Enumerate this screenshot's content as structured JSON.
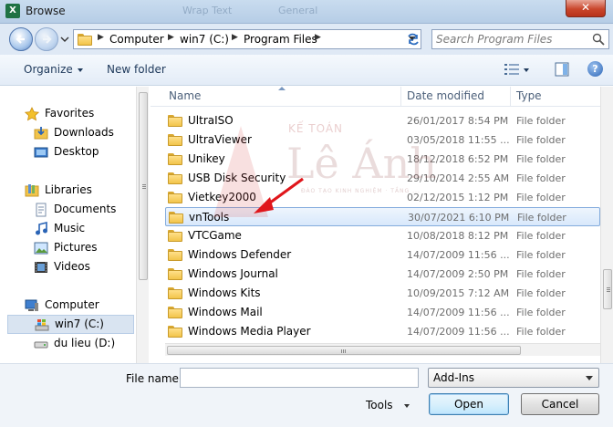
{
  "window": {
    "title": "Browse",
    "app_icon_letter": "X",
    "close_glyph": "✕"
  },
  "background_ghost": [
    "Wrap Text",
    "General"
  ],
  "address": {
    "crumbs": [
      "Computer",
      "win7 (C:)",
      "Program Files"
    ],
    "search_placeholder": "Search Program Files"
  },
  "toolbar": {
    "organize": "Organize",
    "new_folder": "New folder",
    "help": "?"
  },
  "nav": {
    "favorites": "Favorites",
    "downloads": "Downloads",
    "desktop": "Desktop",
    "libraries": "Libraries",
    "documents": "Documents",
    "music": "Music",
    "pictures": "Pictures",
    "videos": "Videos",
    "computer": "Computer",
    "drive_c": "win7 (C:)",
    "drive_d": "du lieu (D:)"
  },
  "columns": {
    "name": "Name",
    "date": "Date modified",
    "type": "Type"
  },
  "files": [
    {
      "name": "UltraISO",
      "date": "26/01/2017 8:54 PM",
      "type": "File folder"
    },
    {
      "name": "UltraViewer",
      "date": "03/05/2018 11:55 ...",
      "type": "File folder"
    },
    {
      "name": "Unikey",
      "date": "18/12/2018 6:52 PM",
      "type": "File folder"
    },
    {
      "name": "USB Disk Security",
      "date": "29/10/2014 2:55 AM",
      "type": "File folder"
    },
    {
      "name": "Vietkey2000",
      "date": "02/12/2015 1:12 PM",
      "type": "File folder"
    },
    {
      "name": "vnTools",
      "date": "30/07/2021 6:10 PM",
      "type": "File folder"
    },
    {
      "name": "VTCGame",
      "date": "10/08/2018 8:12 PM",
      "type": "File folder"
    },
    {
      "name": "Windows Defender",
      "date": "14/07/2009 11:56 ...",
      "type": "File folder"
    },
    {
      "name": "Windows Journal",
      "date": "14/07/2009 2:50 PM",
      "type": "File folder"
    },
    {
      "name": "Windows Kits",
      "date": "10/09/2015 7:12 AM",
      "type": "File folder"
    },
    {
      "name": "Windows Mail",
      "date": "14/07/2009 11:56 ...",
      "type": "File folder"
    },
    {
      "name": "Windows Media Player",
      "date": "14/07/2009 11:56 ...",
      "type": "File folder"
    }
  ],
  "watermark": {
    "small": "KẾ TOÁN",
    "big": "Lê Ánh",
    "tiny": "ĐÀO TẠO KINH NGHIỆM · TẦNG ..."
  },
  "bottom": {
    "file_name_label": "File name:",
    "file_name_value": "",
    "filter_value": "Add-Ins",
    "tools": "Tools",
    "open": "Open",
    "cancel": "Cancel"
  },
  "colors": {
    "accent_red": "#e0161b",
    "selection": "#d8e8fb"
  }
}
